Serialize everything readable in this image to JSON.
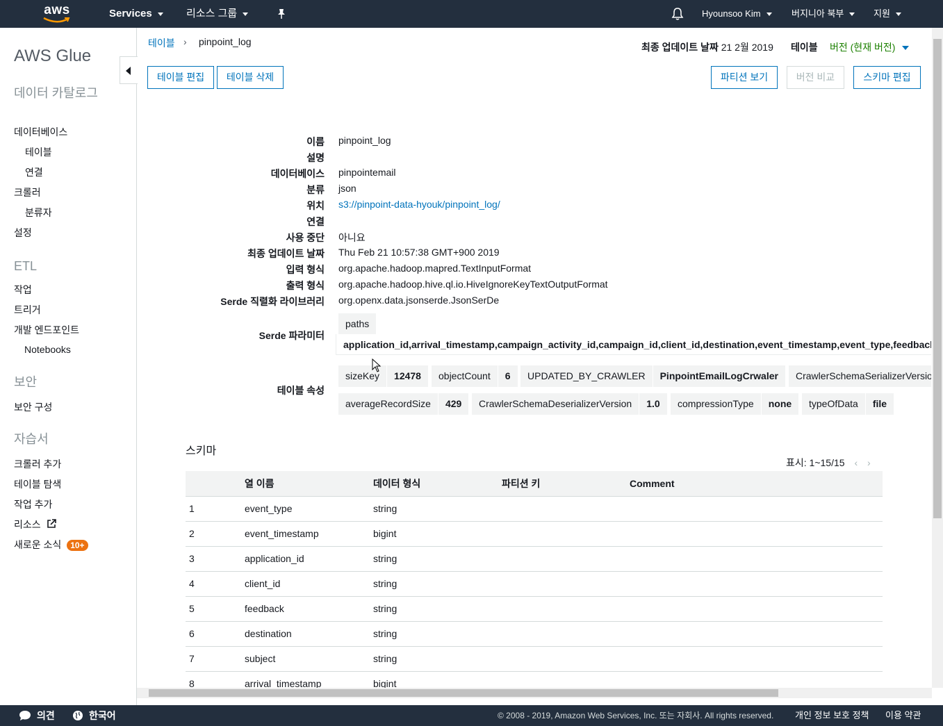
{
  "topnav": {
    "logo": "aws",
    "services": "Services",
    "resource_groups": "리소스 그룹",
    "pin_icon": "pin-icon",
    "bell_icon": "bell-icon",
    "user": "Hyounsoo Kim",
    "region": "버지니아 북부",
    "support": "지원"
  },
  "sidebar": {
    "title": "AWS Glue",
    "catalog_section": "데이터 카탈로그",
    "databases": "데이터베이스",
    "tables": "테이블",
    "connections": "연결",
    "crawlers": "크롤러",
    "classifiers": "분류자",
    "settings": "설정",
    "etl_section": "ETL",
    "jobs": "작업",
    "triggers": "트리거",
    "dev_endpoints": "개발 엔드포인트",
    "notebooks": "Notebooks",
    "security_section": "보안",
    "security_config": "보안 구성",
    "tutorials_section": "자습서",
    "add_crawler": "크롤러 추가",
    "explore_table": "테이블 탐색",
    "add_job": "작업 추가",
    "resources": "리소스",
    "whats_new": "새로운 소식",
    "whats_new_badge": "10+"
  },
  "breadcrumb": {
    "parent": "테이블",
    "separator": "›",
    "current": "pinpoint_log"
  },
  "header": {
    "last_updated_label": "최종 업데이트 날짜",
    "last_updated_value": "21 2월 2019",
    "table_label": "테이블",
    "version_label": "버전 (현재 버전)"
  },
  "actions": {
    "edit_table": "테이블 편집",
    "delete_table": "테이블 삭제",
    "view_partitions": "파티션 보기",
    "compare_versions": "버전 비교",
    "edit_schema": "스키마 편집"
  },
  "details": {
    "name_label": "이름",
    "name_value": "pinpoint_log",
    "desc_label": "설명",
    "db_label": "데이터베이스",
    "db_value": "pinpointemail",
    "class_label": "분류",
    "class_value": "json",
    "location_label": "위치",
    "location_value": "s3://pinpoint-data-hyouk/pinpoint_log/",
    "conn_label": "연결",
    "deprecated_label": "사용 중단",
    "deprecated_value": "아니요",
    "updated_label": "최종 업데이트 날짜",
    "updated_value": "Thu Feb 21 10:57:38 GMT+900 2019",
    "input_label": "입력 형식",
    "input_value": "org.apache.hadoop.mapred.TextInputFormat",
    "output_label": "출력 형식",
    "output_value": "org.apache.hadoop.hive.ql.io.HiveIgnoreKeyTextOutputFormat",
    "serde_lib_label": "Serde 직렬화 라이브러리",
    "serde_lib_value": "org.openx.data.jsonserde.JsonSerDe",
    "serde_params_label": "Serde 파라미터",
    "serde_param_key": "paths",
    "serde_param_value": "application_id,arrival_timestamp,campaign_activity_id,campaign_id,client_id,destination,event_timestamp,event_type,feedback",
    "table_props_label": "테이블 속성"
  },
  "table_props": [
    {
      "k": "sizeKey",
      "v": "12478"
    },
    {
      "k": "objectCount",
      "v": "6"
    },
    {
      "k": "UPDATED_BY_CRAWLER",
      "v": "PinpointEmailLogCrwaler"
    },
    {
      "k": "CrawlerSchemaSerializerVersion",
      "v": ""
    },
    {
      "k": "averageRecordSize",
      "v": "429"
    },
    {
      "k": "CrawlerSchemaDeserializerVersion",
      "v": "1.0"
    },
    {
      "k": "compressionType",
      "v": "none"
    },
    {
      "k": "typeOfData",
      "v": "file"
    }
  ],
  "schema": {
    "title": "스키마",
    "pager": "표시: 1~15/15",
    "columns": [
      "",
      "열 이름",
      "데이터 형식",
      "파티션 키",
      "Comment"
    ],
    "rows": [
      [
        "1",
        "event_type",
        "string"
      ],
      [
        "2",
        "event_timestamp",
        "bigint"
      ],
      [
        "3",
        "application_id",
        "string"
      ],
      [
        "4",
        "client_id",
        "string"
      ],
      [
        "5",
        "feedback",
        "string"
      ],
      [
        "6",
        "destination",
        "string"
      ],
      [
        "7",
        "subject",
        "string"
      ],
      [
        "8",
        "arrival_timestamp",
        "bigint"
      ]
    ]
  },
  "footer": {
    "feedback": "의견",
    "language": "한국어",
    "copyright": "© 2008 - 2019, Amazon Web Services, Inc. 또는 자회사. All rights reserved.",
    "privacy": "개인 정보 보호 정책",
    "terms": "이용 약관"
  },
  "colors": {
    "nav_bg": "#232f3e",
    "link": "#0073bb",
    "accent_green": "#1d8102",
    "badge": "#ec7211"
  }
}
